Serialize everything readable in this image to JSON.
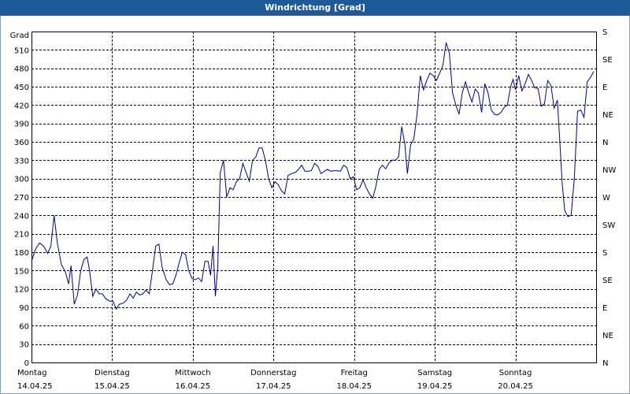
{
  "title": "Windrichtung [Grad]",
  "chart_data": {
    "type": "line",
    "title": "Windrichtung [Grad]",
    "ylabel": "Grad",
    "ylim": [
      0,
      540
    ],
    "yticks": [
      0,
      30,
      60,
      90,
      120,
      150,
      180,
      210,
      240,
      270,
      300,
      330,
      360,
      390,
      420,
      450,
      480,
      510
    ],
    "right_axis_labels": [
      "N",
      "NE",
      "E",
      "SE",
      "S",
      "SW",
      "W",
      "NW",
      "N",
      "NE",
      "E",
      "SE",
      "S"
    ],
    "xlim": [
      0,
      7
    ],
    "x_labels": [
      {
        "day": "Montag",
        "date": "14.04.25"
      },
      {
        "day": "Dienstag",
        "date": "15.04.25"
      },
      {
        "day": "Mittwoch",
        "date": "16.04.25"
      },
      {
        "day": "Donnerstag",
        "date": "17.04.25"
      },
      {
        "day": "Freitag",
        "date": "18.04.25"
      },
      {
        "day": "Samstag",
        "date": "19.04.25"
      },
      {
        "day": "Sonntag",
        "date": "20.04.25"
      }
    ],
    "grid": true,
    "color": "#00008b",
    "series": [
      {
        "values": [
          [
            0.0,
            165
          ],
          [
            0.05,
            185
          ],
          [
            0.1,
            195
          ],
          [
            0.15,
            190
          ],
          [
            0.2,
            178
          ],
          [
            0.24,
            190
          ],
          [
            0.28,
            240
          ],
          [
            0.32,
            195
          ],
          [
            0.37,
            160
          ],
          [
            0.42,
            148
          ],
          [
            0.46,
            128
          ],
          [
            0.49,
            158
          ],
          [
            0.53,
            95
          ],
          [
            0.57,
            110
          ],
          [
            0.61,
            150
          ],
          [
            0.65,
            168
          ],
          [
            0.69,
            172
          ],
          [
            0.72,
            150
          ],
          [
            0.76,
            108
          ],
          [
            0.8,
            120
          ],
          [
            0.84,
            112
          ],
          [
            0.88,
            112
          ],
          [
            0.92,
            104
          ],
          [
            0.97,
            100
          ],
          [
            1.01,
            100
          ],
          [
            1.05,
            87
          ],
          [
            1.09,
            95
          ],
          [
            1.14,
            97
          ],
          [
            1.18,
            102
          ],
          [
            1.22,
            112
          ],
          [
            1.26,
            105
          ],
          [
            1.3,
            115
          ],
          [
            1.34,
            110
          ],
          [
            1.38,
            112
          ],
          [
            1.42,
            118
          ],
          [
            1.46,
            112
          ],
          [
            1.5,
            150
          ],
          [
            1.54,
            190
          ],
          [
            1.58,
            193
          ],
          [
            1.62,
            155
          ],
          [
            1.67,
            135
          ],
          [
            1.71,
            127
          ],
          [
            1.75,
            128
          ],
          [
            1.79,
            142
          ],
          [
            1.83,
            162
          ],
          [
            1.87,
            180
          ],
          [
            1.91,
            176
          ],
          [
            1.95,
            150
          ],
          [
            1.99,
            137
          ],
          [
            2.03,
            135
          ],
          [
            2.07,
            138
          ],
          [
            2.11,
            132
          ],
          [
            2.15,
            165
          ],
          [
            2.19,
            165
          ],
          [
            2.22,
            142
          ],
          [
            2.25,
            190
          ],
          [
            2.28,
            108
          ],
          [
            2.31,
            158
          ],
          [
            2.34,
            310
          ],
          [
            2.38,
            330
          ],
          [
            2.42,
            270
          ],
          [
            2.46,
            285
          ],
          [
            2.5,
            282
          ],
          [
            2.54,
            295
          ],
          [
            2.58,
            300
          ],
          [
            2.62,
            325
          ],
          [
            2.66,
            310
          ],
          [
            2.7,
            296
          ],
          [
            2.74,
            330
          ],
          [
            2.78,
            335
          ],
          [
            2.82,
            350
          ],
          [
            2.86,
            350
          ],
          [
            2.9,
            330
          ],
          [
            2.94,
            300
          ],
          [
            2.98,
            285
          ],
          [
            3.02,
            295
          ],
          [
            3.06,
            290
          ],
          [
            3.1,
            280
          ],
          [
            3.14,
            275
          ],
          [
            3.18,
            305
          ],
          [
            3.22,
            308
          ],
          [
            3.27,
            310
          ],
          [
            3.31,
            315
          ],
          [
            3.35,
            322
          ],
          [
            3.39,
            312
          ],
          [
            3.43,
            312
          ],
          [
            3.47,
            313
          ],
          [
            3.51,
            325
          ],
          [
            3.55,
            320
          ],
          [
            3.59,
            308
          ],
          [
            3.63,
            312
          ],
          [
            3.67,
            315
          ],
          [
            3.71,
            312
          ],
          [
            3.75,
            313
          ],
          [
            3.79,
            313
          ],
          [
            3.83,
            312
          ],
          [
            3.87,
            322
          ],
          [
            3.91,
            318
          ],
          [
            3.95,
            300
          ],
          [
            3.99,
            303
          ],
          [
            4.03,
            282
          ],
          [
            4.07,
            285
          ],
          [
            4.11,
            298
          ],
          [
            4.15,
            285
          ],
          [
            4.19,
            275
          ],
          [
            4.23,
            268
          ],
          [
            4.27,
            288
          ],
          [
            4.31,
            315
          ],
          [
            4.35,
            322
          ],
          [
            4.39,
            316
          ],
          [
            4.43,
            325
          ],
          [
            4.47,
            330
          ],
          [
            4.51,
            330
          ],
          [
            4.55,
            335
          ],
          [
            4.59,
            385
          ],
          [
            4.63,
            355
          ],
          [
            4.66,
            308
          ],
          [
            4.7,
            355
          ],
          [
            4.74,
            365
          ],
          [
            4.78,
            405
          ],
          [
            4.82,
            468
          ],
          [
            4.86,
            445
          ],
          [
            4.9,
            460
          ],
          [
            4.94,
            472
          ],
          [
            4.98,
            468
          ],
          [
            5.02,
            460
          ],
          [
            5.06,
            472
          ],
          [
            5.1,
            485
          ],
          [
            5.14,
            522
          ],
          [
            5.18,
            505
          ],
          [
            5.22,
            440
          ],
          [
            5.26,
            420
          ],
          [
            5.3,
            405
          ],
          [
            5.34,
            440
          ],
          [
            5.38,
            458
          ],
          [
            5.42,
            440
          ],
          [
            5.46,
            425
          ],
          [
            5.5,
            446
          ],
          [
            5.54,
            440
          ],
          [
            5.58,
            408
          ],
          [
            5.62,
            455
          ],
          [
            5.66,
            440
          ],
          [
            5.7,
            412
          ],
          [
            5.74,
            405
          ],
          [
            5.78,
            404
          ],
          [
            5.82,
            408
          ],
          [
            5.86,
            416
          ],
          [
            5.9,
            420
          ],
          [
            5.94,
            450
          ],
          [
            5.97,
            462
          ],
          [
            6.0,
            445
          ],
          [
            6.04,
            468
          ],
          [
            6.08,
            443
          ],
          [
            6.12,
            455
          ],
          [
            6.16,
            470
          ],
          [
            6.2,
            460
          ],
          [
            6.24,
            448
          ],
          [
            6.28,
            447
          ],
          [
            6.32,
            418
          ],
          [
            6.36,
            422
          ],
          [
            6.4,
            460
          ],
          [
            6.44,
            452
          ],
          [
            6.48,
            415
          ],
          [
            6.52,
            428
          ],
          [
            6.55,
            360
          ],
          [
            6.58,
            290
          ],
          [
            6.61,
            248
          ],
          [
            6.65,
            238
          ],
          [
            6.69,
            240
          ],
          [
            6.73,
            300
          ],
          [
            6.77,
            410
          ],
          [
            6.81,
            412
          ],
          [
            6.85,
            400
          ],
          [
            6.89,
            458
          ],
          [
            6.93,
            465
          ],
          [
            6.97,
            475
          ]
        ]
      }
    ]
  }
}
